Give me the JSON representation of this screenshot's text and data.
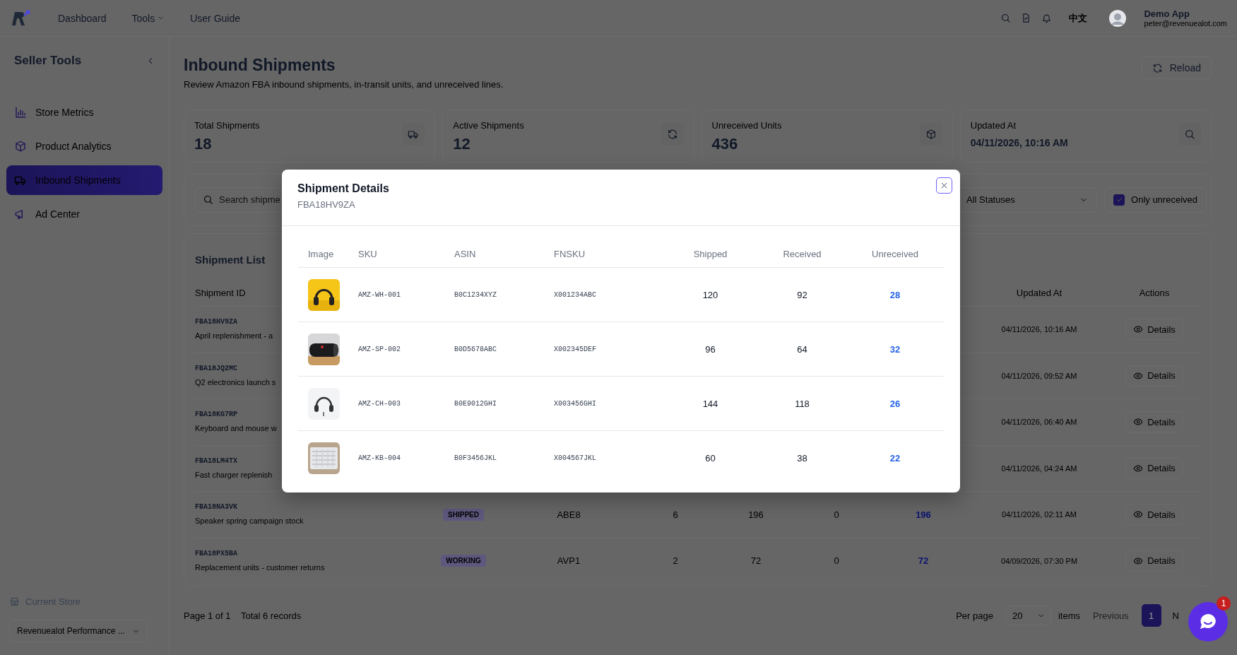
{
  "topbar": {
    "nav": [
      {
        "label": "Dashboard",
        "kind": "link"
      },
      {
        "label": "Tools",
        "kind": "menu"
      },
      {
        "label": "User Guide",
        "kind": "link"
      }
    ],
    "language": "中文",
    "user": {
      "name": "Demo App",
      "email": "peter@revenuealot.com"
    }
  },
  "sidebar": {
    "title": "Seller Tools",
    "items": [
      {
        "label": "Store Metrics",
        "selected": false
      },
      {
        "label": "Product Analytics",
        "selected": false
      },
      {
        "label": "Inbound Shipments",
        "selected": true
      },
      {
        "label": "Ad Center",
        "selected": false
      }
    ],
    "store": {
      "label": "Current Store",
      "value": "Revenuealot Performance ..."
    }
  },
  "page": {
    "title": "Inbound Shipments",
    "subtitle": "Review Amazon FBA inbound shipments, in-transit units, and unreceived lines.",
    "reload": "Reload"
  },
  "stats": [
    {
      "label": "Total Shipments",
      "value": "18",
      "kind": "count"
    },
    {
      "label": "Active Shipments",
      "value": "12",
      "kind": "count"
    },
    {
      "label": "Unreceived Units",
      "value": "436",
      "kind": "count"
    },
    {
      "label": "Updated At",
      "value": "04/11/2026, 10:16 AM",
      "kind": "date"
    }
  ],
  "filters": {
    "search": {
      "placeholder": "Search shipme"
    },
    "status": "All Statuses",
    "only_unreceived": {
      "label": "Only unreceived",
      "checked": true
    }
  },
  "shipment_list": {
    "title": "Shipment List",
    "columns": [
      "Shipment ID",
      "Updated At",
      "Actions"
    ],
    "rows": [
      {
        "id": "FBA18HV9ZA",
        "description": "April replenishment - a",
        "updated_at": "04/11/2026, 10:16 AM",
        "action": "Details"
      },
      {
        "id": "FBA18JQ2MC",
        "description": "Q2 electronics launch s",
        "updated_at": "04/11/2026, 09:52 AM",
        "action": "Details"
      },
      {
        "id": "FBA18KG7RP",
        "description": "Keyboard and mouse w",
        "updated_at": "04/11/2026, 06:40 AM",
        "action": "Details"
      },
      {
        "id": "FBA18LM4TX",
        "description": "Fast charger replenish",
        "updated_at": "04/11/2026, 04:24 AM",
        "action": "Details"
      },
      {
        "id": "FBA18NA3VK",
        "description": "Speaker spring campaign stock",
        "status": "SHIPPED",
        "column_3": "ABE8",
        "numbers": [
          "6",
          "196",
          "0",
          "196"
        ],
        "updated_at": "04/11/2026, 02:11 AM",
        "action": "Details"
      },
      {
        "id": "FBA18PX5BA",
        "description": "Replacement units - customer returns",
        "status": "WORKING",
        "column_3": "AVP1",
        "numbers": [
          "2",
          "72",
          "0",
          "72"
        ],
        "updated_at": "04/09/2026, 07:30 PM",
        "action": "Details"
      }
    ]
  },
  "pagination": {
    "summary": "Page 1 of 1",
    "total": "Total 6 records",
    "per_page_label": "Per page",
    "per_page": "20",
    "items_label": "items",
    "previous": "Previous",
    "pages": [
      {
        "label": "1",
        "selected": true
      }
    ],
    "next": "N"
  },
  "modal": {
    "title": "Shipment Details",
    "subtitle": "FBA18HV9ZA",
    "columns": [
      "Image",
      "SKU",
      "ASIN",
      "FNSKU",
      "Shipped",
      "Received",
      "Unreceived"
    ],
    "rows": [
      {
        "sku": "AMZ-WH-001",
        "asin": "B0C1234XYZ",
        "fnsku": "X001234ABC",
        "shipped": "120",
        "received": "92",
        "unreceived": "28"
      },
      {
        "sku": "AMZ-SP-002",
        "asin": "B0D5678ABC",
        "fnsku": "X002345DEF",
        "shipped": "96",
        "received": "64",
        "unreceived": "32"
      },
      {
        "sku": "AMZ-CH-003",
        "asin": "B0E9012GHI",
        "fnsku": "X003456GHI",
        "shipped": "144",
        "received": "118",
        "unreceived": "26"
      },
      {
        "sku": "AMZ-KB-004",
        "asin": "B0F3456JKL",
        "fnsku": "X004567JKL",
        "shipped": "60",
        "received": "38",
        "unreceived": "22"
      }
    ]
  },
  "chat": {
    "badge": "1"
  }
}
